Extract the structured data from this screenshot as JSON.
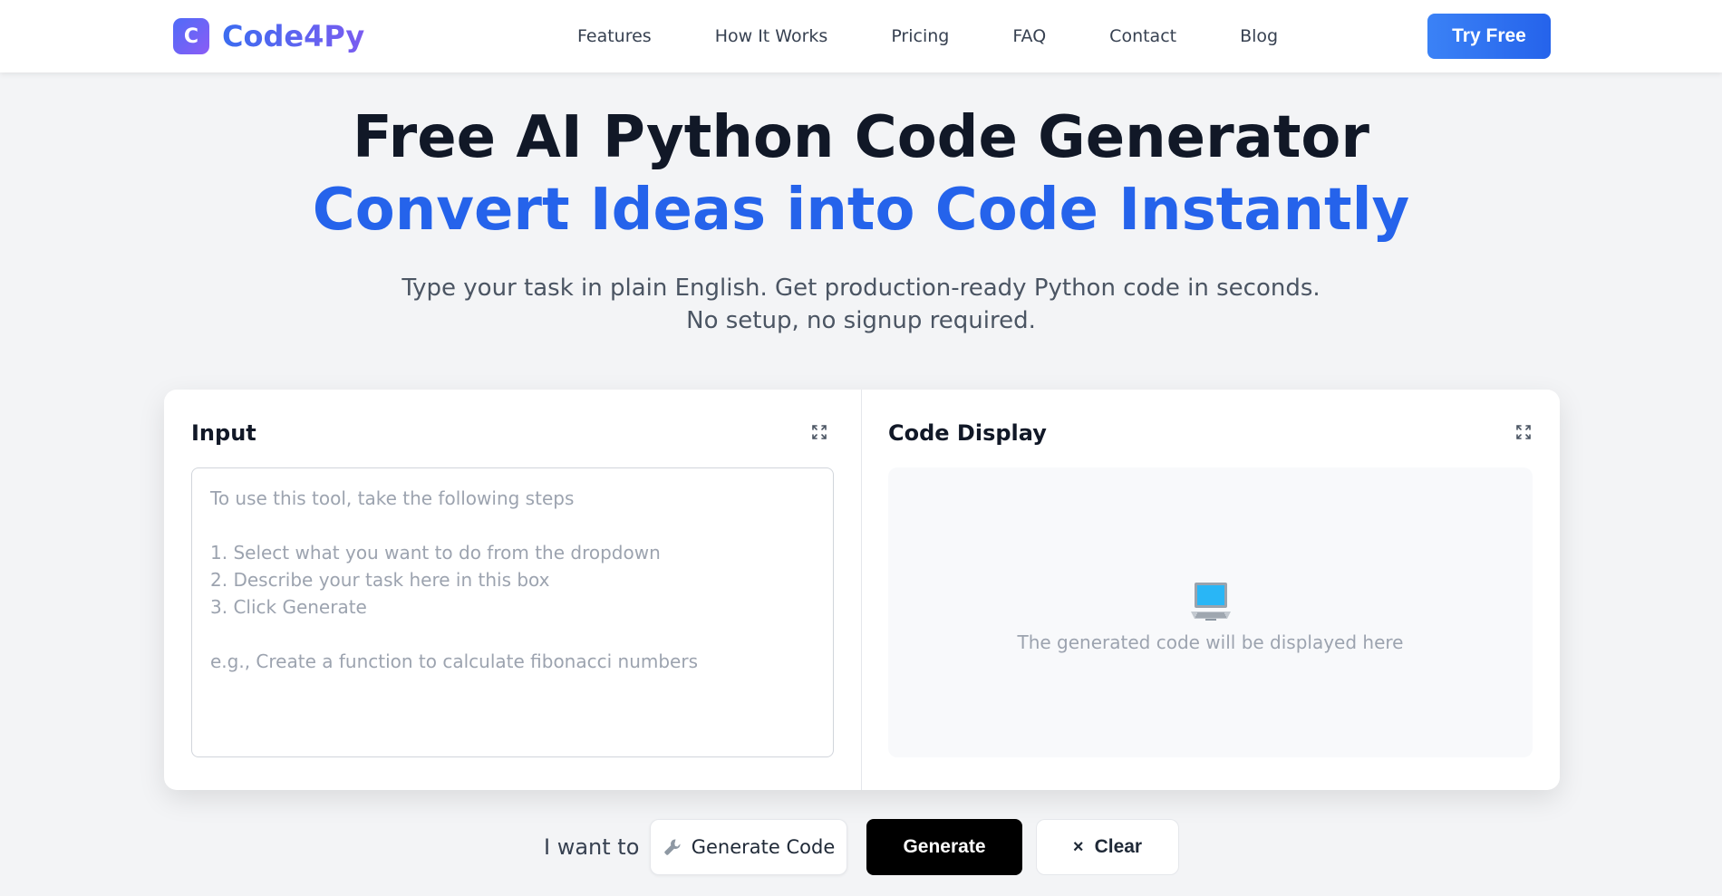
{
  "header": {
    "logo_letter": "C",
    "brand": "Code4Py",
    "nav": [
      "Features",
      "How It Works",
      "Pricing",
      "FAQ",
      "Contact",
      "Blog"
    ],
    "cta": "Try Free"
  },
  "hero": {
    "title": "Free AI Python Code Generator",
    "subtitle": "Convert Ideas into Code Instantly",
    "desc_line1": "Type your task in plain English. Get production-ready Python code in seconds.",
    "desc_line2": "No setup, no signup required."
  },
  "input_panel": {
    "title": "Input",
    "placeholder": "To use this tool, take the following steps\n\n1. Select what you want to do from the dropdown\n2. Describe your task here in this box\n3. Click Generate\n\ne.g., Create a function to calculate fibonacci numbers",
    "value": ""
  },
  "code_panel": {
    "title": "Code Display",
    "placeholder": "The generated code will be displayed here"
  },
  "controls": {
    "want_label": "I want to",
    "selected_action": "Generate Code",
    "generate_label": "Generate",
    "clear_label": "Clear"
  },
  "colors": {
    "accent": "#2563eb",
    "brand_gradient_start": "#4f6cf7",
    "brand_gradient_end": "#8b5cf6",
    "primary_button": "#000000"
  }
}
